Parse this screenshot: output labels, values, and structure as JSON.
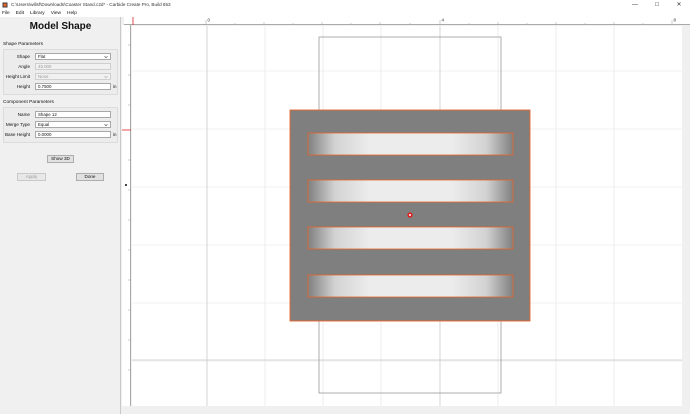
{
  "window": {
    "title": "C:\\Users\\willsf\\Downloads\\Coaster Stand.c2d* - Carbide Create Pro, Build 653",
    "controls": {
      "minimize": "—",
      "maximize": "☐",
      "close": "✕"
    }
  },
  "menu": {
    "items": [
      "File",
      "Edit",
      "Library",
      "View",
      "Help"
    ]
  },
  "panel": {
    "heading": "Model Shape",
    "shape_params": {
      "label": "Shape Parameters",
      "shape_label": "Shape",
      "shape_value": "Flat",
      "angle_label": "Angle",
      "angle_value": "45.000",
      "height_limit_label": "Height Limit",
      "height_limit_value": "None",
      "height_label": "Height",
      "height_value": "0.7500",
      "height_unit": "in"
    },
    "component_params": {
      "label": "Component Parameters",
      "name_label": "Name",
      "name_value": "Shape 12",
      "merge_label": "Merge Type",
      "merge_value": "Equal",
      "base_label": "Base Height",
      "base_value": "0.0000",
      "base_unit": "in"
    },
    "show3d_label": "Show 3D",
    "apply_label": "Apply",
    "done_label": "Done"
  },
  "ruler": {
    "ticks": [
      "0",
      "4",
      "8"
    ]
  },
  "colors": {
    "accent": "#e8652c",
    "material": "#7f7f7f",
    "center_marker": "#e02020"
  },
  "icons": {
    "app": "carbide-create-icon",
    "dropdown": "chevron-down-icon"
  }
}
